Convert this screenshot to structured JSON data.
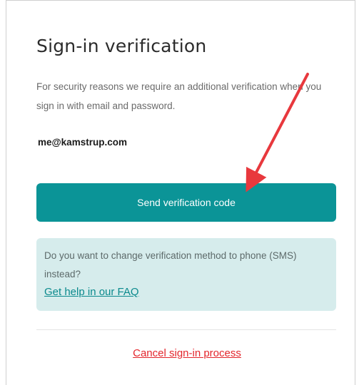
{
  "page": {
    "title": "Sign-in verification",
    "intro": "For security reasons we require an additional verification when you sign in with email and password.",
    "email": "me@kamstrup.com"
  },
  "actions": {
    "send_code_label": "Send verification code",
    "cancel_label": "Cancel sign-in process"
  },
  "info_box": {
    "text": "Do you want to change verification method to phone (SMS) instead?",
    "faq_link": "Get help in our FAQ"
  },
  "annotation": {
    "arrow_color": "#e8383d"
  },
  "colors": {
    "primary": "#0b9497",
    "info_background": "#d6ecec",
    "link": "#0b8a8d",
    "cancel": "#e3262c"
  }
}
